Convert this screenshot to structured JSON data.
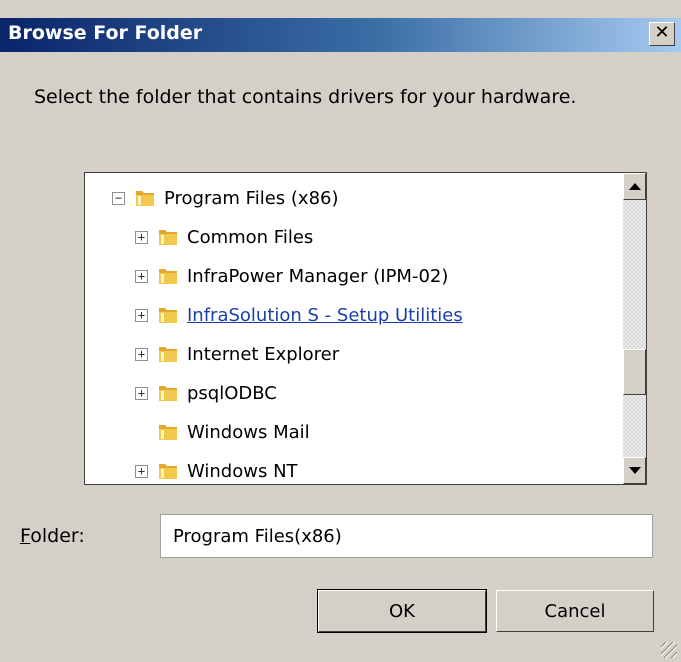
{
  "window": {
    "title": "Browse For Folder",
    "close_glyph": "✕"
  },
  "instruction": "Select the folder that contains drivers for your hardware.",
  "tree": {
    "items": [
      {
        "label": "Program Files (x86)",
        "expander": "−",
        "level": 0,
        "selected": false,
        "link": false
      },
      {
        "label": "Common Files",
        "expander": "+",
        "level": 1,
        "link": false
      },
      {
        "label": "InfraPower Manager (IPM-02)",
        "expander": "+",
        "level": 1,
        "link": false
      },
      {
        "label": "InfraSolution S - Setup Utilities",
        "expander": "+",
        "level": 1,
        "link": true
      },
      {
        "label": "Internet Explorer",
        "expander": "+",
        "level": 1,
        "link": false
      },
      {
        "label": "psqlODBC",
        "expander": "+",
        "level": 1,
        "link": false
      },
      {
        "label": "Windows Mail",
        "expander": "",
        "level": 1,
        "link": false
      },
      {
        "label": "Windows NT",
        "expander": "+",
        "level": 1,
        "link": false
      }
    ],
    "scroll_position": 0.55
  },
  "folder_field": {
    "label_prefix": "",
    "label_accel": "F",
    "label_rest": "older:",
    "value": "Program Files(x86)"
  },
  "buttons": {
    "ok": "OK",
    "cancel": "Cancel"
  },
  "colors": {
    "title_start": "#0a246a",
    "title_end": "#a6caf0",
    "link": "#1a3fa8",
    "folder_yellow": "#f2c94c"
  },
  "icons": {
    "folder": "folder-icon",
    "close": "close-icon",
    "scroll_up": "arrow-up-icon",
    "scroll_down": "arrow-down-icon"
  }
}
